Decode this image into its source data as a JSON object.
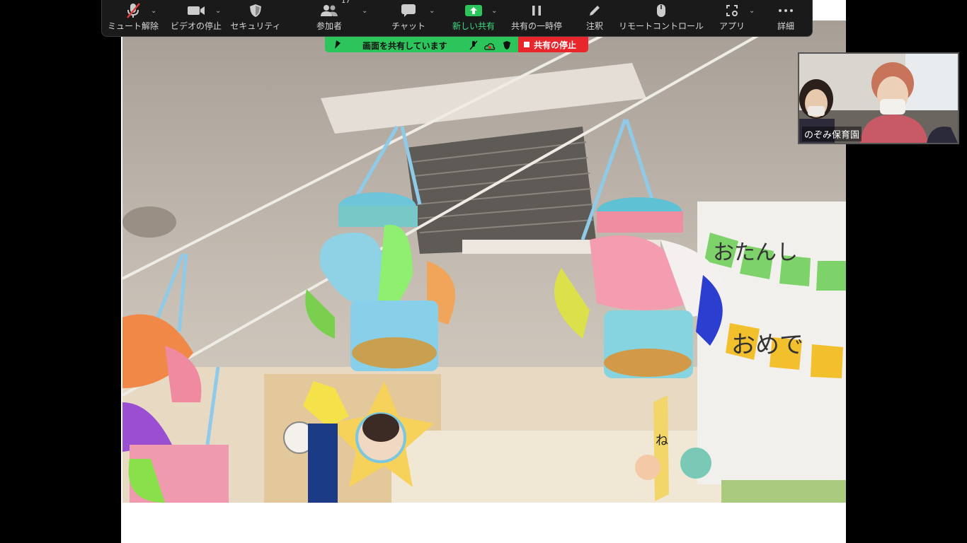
{
  "toolbar": {
    "mute_label": "ミュート解除",
    "video_label": "ビデオの停止",
    "security_label": "セキュリティ",
    "participants_label": "参加者",
    "participants_count": "17",
    "chat_label": "チャット",
    "new_share_label": "新しい共有",
    "pause_share_label": "共有の一時停",
    "annotate_label": "注釈",
    "remote_control_label": "リモートコントロール",
    "apps_label": "アプリ",
    "more_label": "詳細"
  },
  "share_banner": {
    "status_text": "画面を共有しています",
    "stop_label": "共有の停止"
  },
  "video": {
    "participant_name": "のぞみ保育園"
  },
  "photo": {
    "sign_line1": "おたんし",
    "sign_line2": "おめで",
    "tag_text": "ね"
  },
  "colors": {
    "toolbar_bg": "#1a1a1a",
    "share_green": "#2bc55b",
    "stop_red": "#e8262b",
    "active_green": "#3ddc84"
  }
}
